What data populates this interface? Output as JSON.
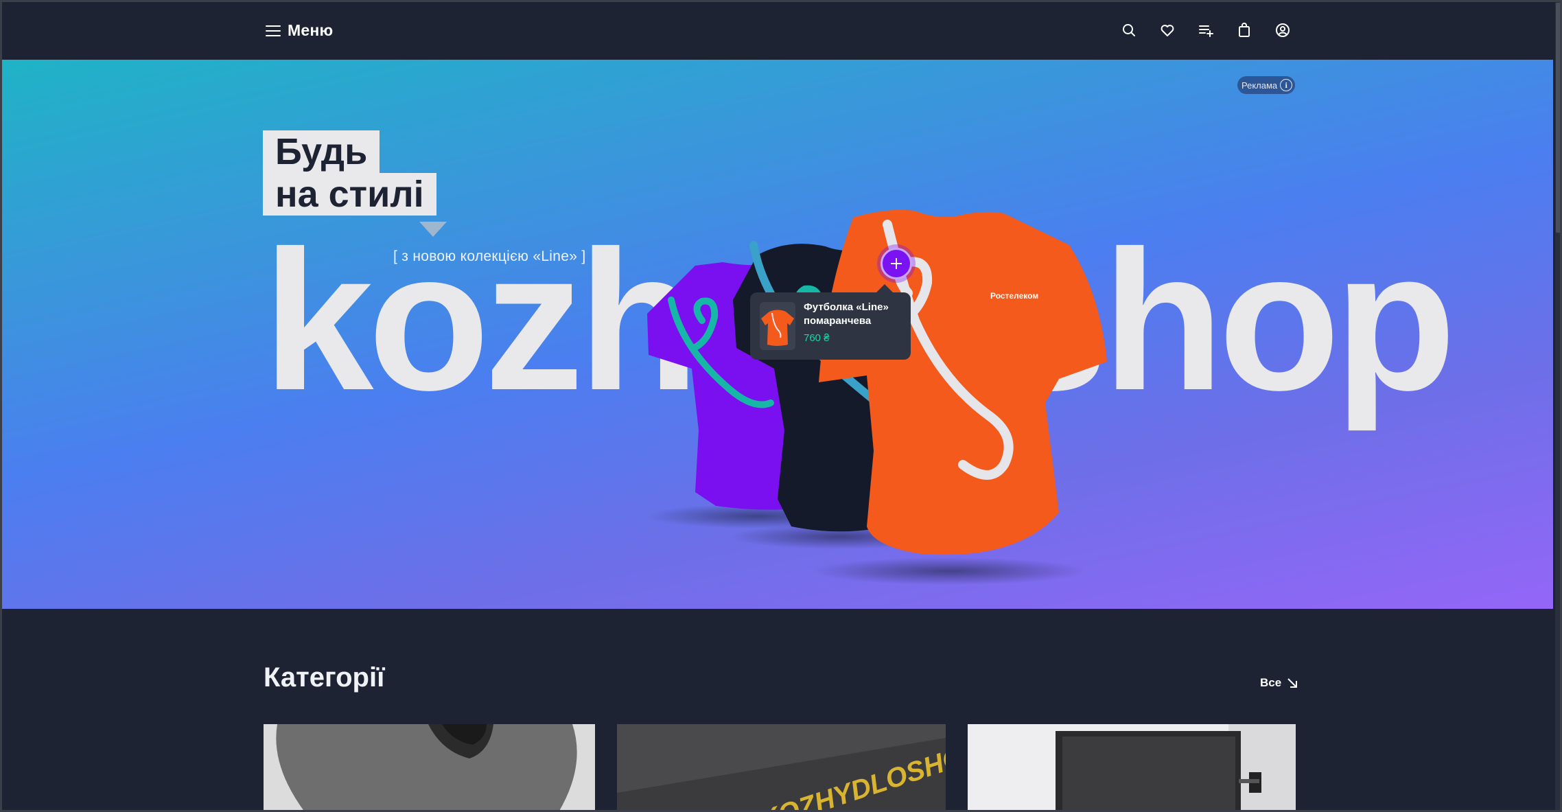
{
  "header": {
    "menu_label": "Меню",
    "icons": [
      "search-icon",
      "heart-icon",
      "playlist-add-icon",
      "shopping-bag-icon",
      "user-icon"
    ]
  },
  "hero": {
    "ad_label": "Реклама",
    "ad_info": "i",
    "headline_line1": "Будь",
    "headline_line2": "на стилі",
    "subtitle": "[ з новою колекцією «Line» ]",
    "brand_left": "kozhy",
    "brand_right": "shop",
    "shirt_print": "Ростелеком",
    "product": {
      "name": "Футболка «Line» помаранчева",
      "price": "760 ₴"
    },
    "colors": {
      "shirt_purple": "#7a0ff0",
      "shirt_black": "#151a2a",
      "shirt_orange": "#f35a1c",
      "line_teal": "#16b7a6"
    }
  },
  "categories": {
    "title": "Категорії",
    "all_label": "Все",
    "card2_text": "KOZHYDLOSHOP"
  },
  "theme": {
    "background": "#1e2333",
    "accent": "#7a12f2",
    "price_color": "#1dd3a7"
  }
}
